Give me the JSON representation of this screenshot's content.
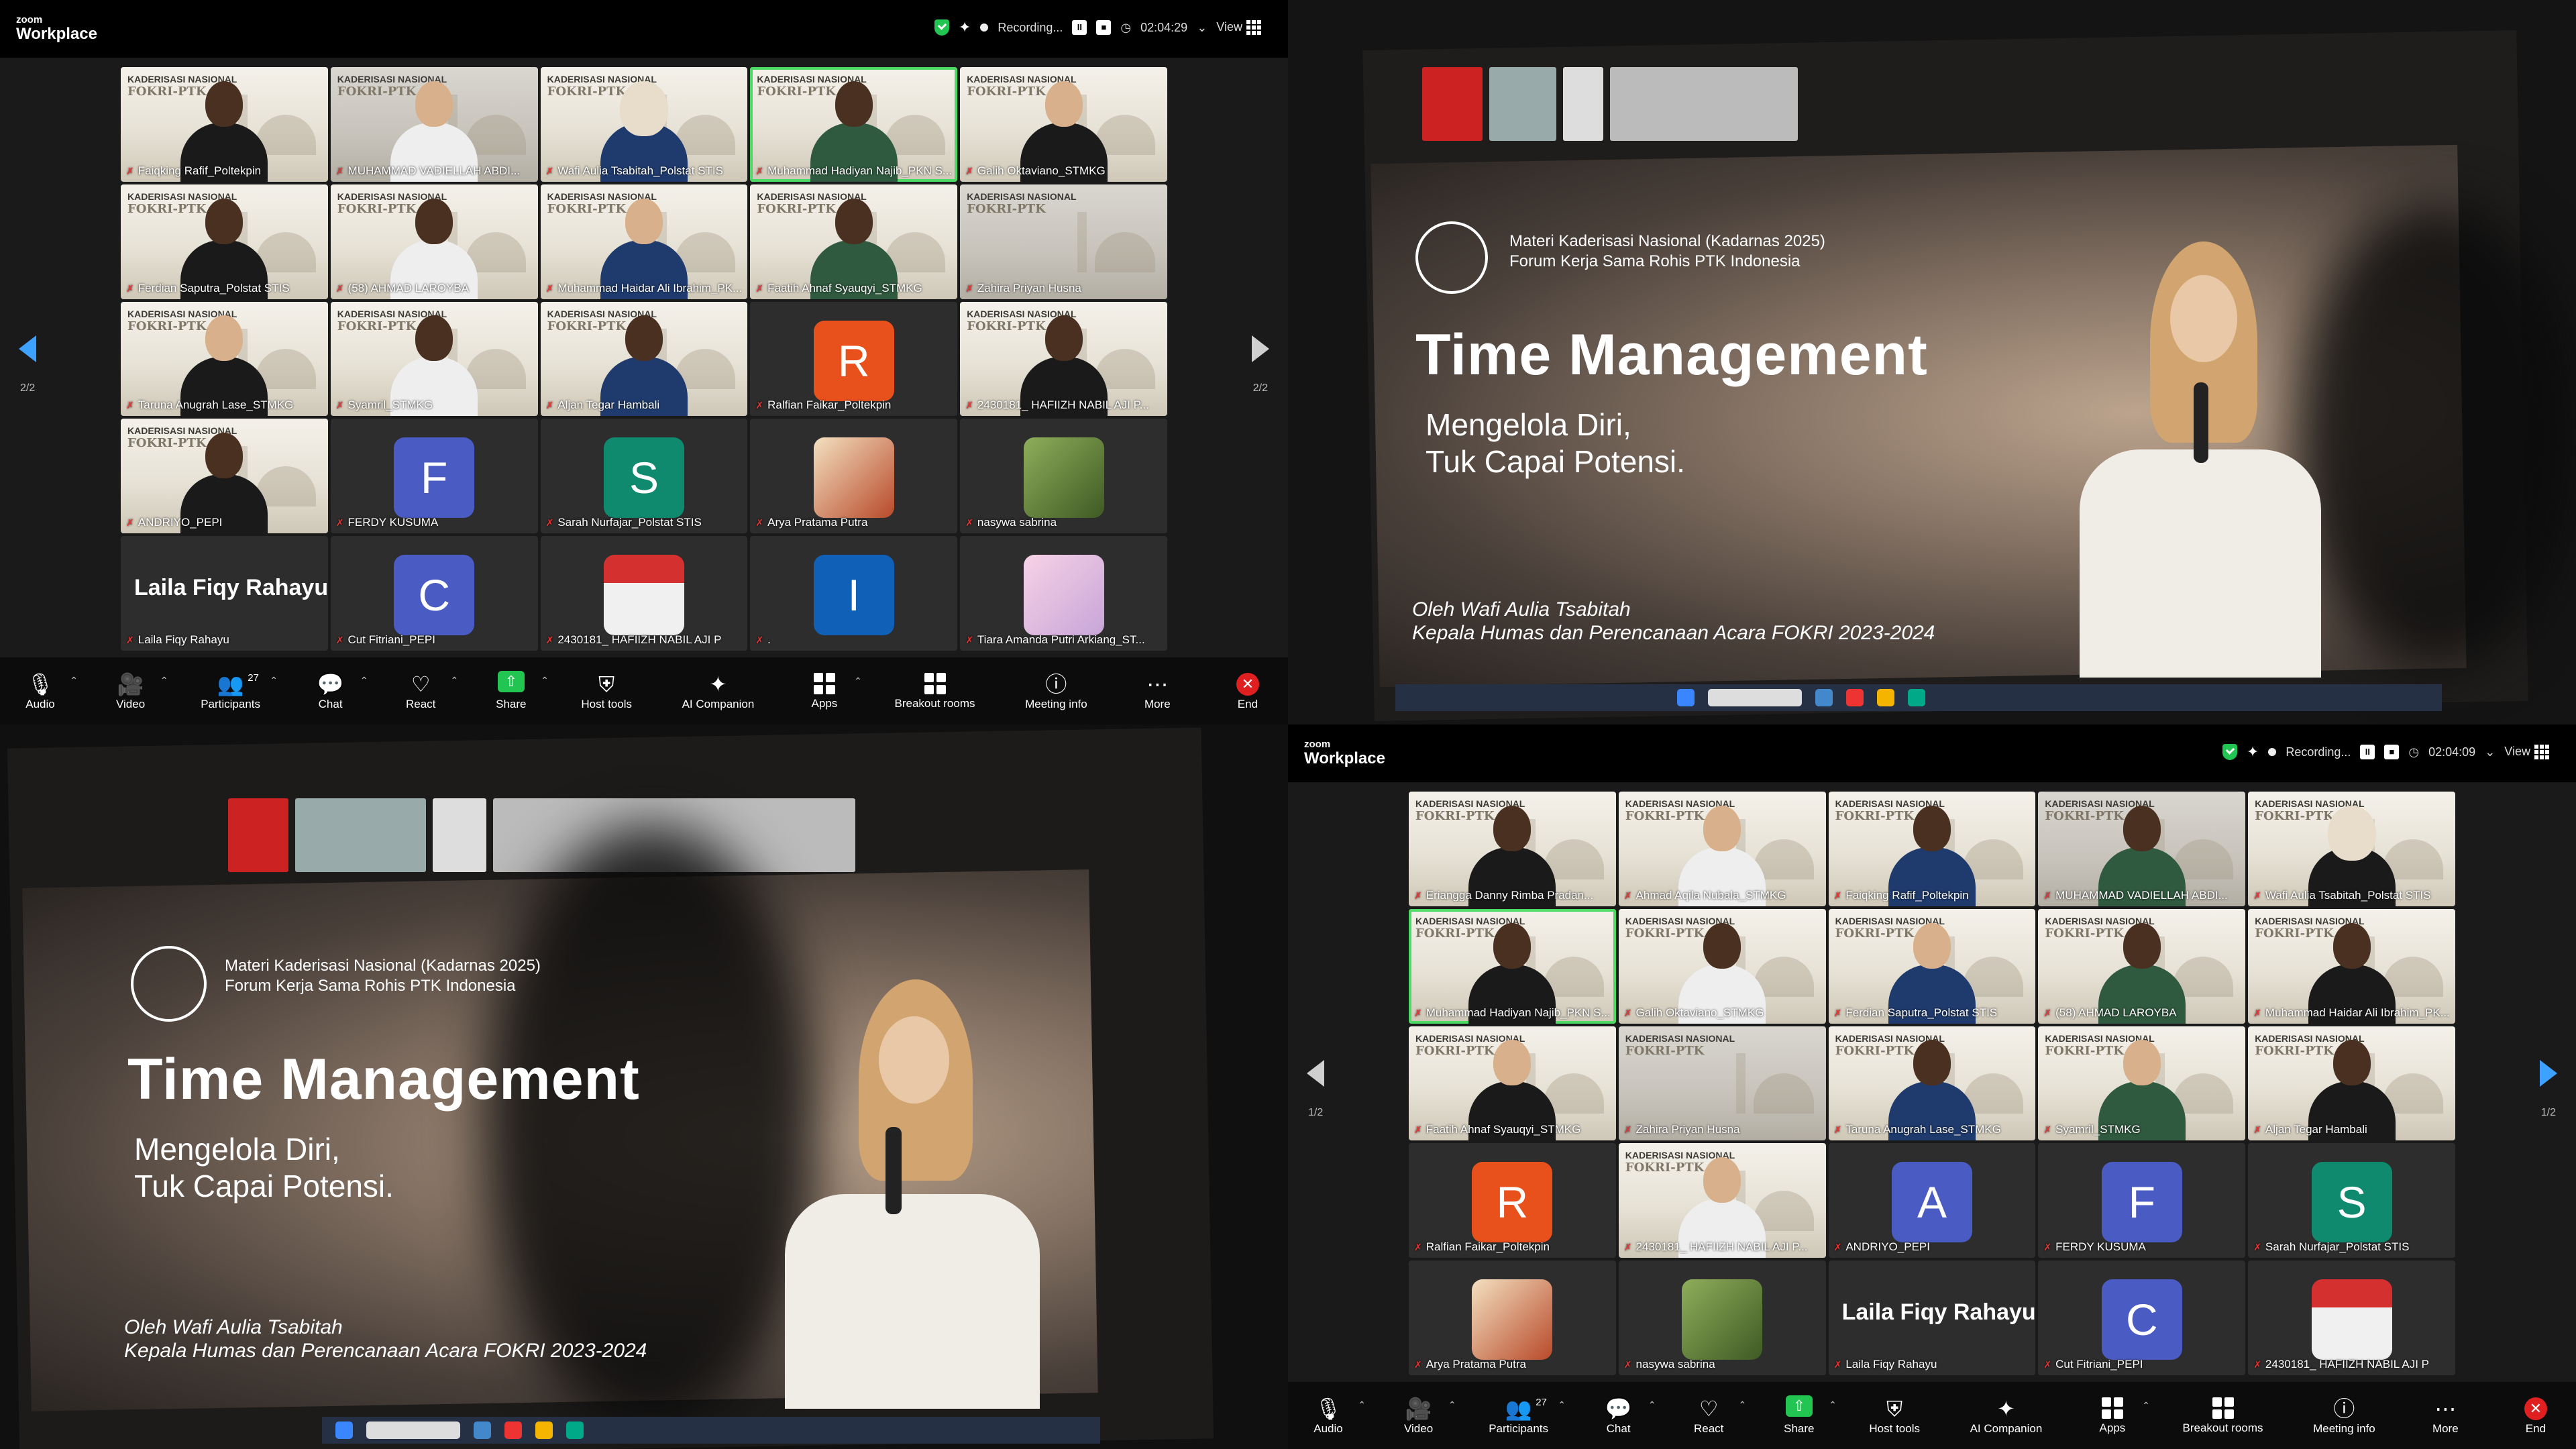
{
  "brand": {
    "small": "zoom",
    "big": "Workplace"
  },
  "recording": {
    "label": "Recording...",
    "pause": "II",
    "stop": "■"
  },
  "timers": {
    "tl": "02:04:29",
    "br": "02:04:09"
  },
  "view_label": "View",
  "page_indicators": {
    "tl": "2/2",
    "br": "1/2"
  },
  "toolbar": {
    "audio": "Audio",
    "video": "Video",
    "participants": "Participants",
    "participants_count": "27",
    "chat": "Chat",
    "react": "React",
    "share": "Share",
    "host_tools": "Host tools",
    "ai_companion": "AI Companion",
    "apps": "Apps",
    "breakout": "Breakout rooms",
    "meeting_info": "Meeting info",
    "more": "More",
    "end": "End"
  },
  "tile_header": {
    "line1": "KADERISASI NASIONAL",
    "line2": "FOKRI-PTK"
  },
  "grid_tl": [
    {
      "name": "Faiqking Rafif_Poltekpin",
      "type": "video"
    },
    {
      "name": "MUHAMMAD VADIELLAH ABDI...",
      "type": "video"
    },
    {
      "name": "Wafi Aulia Tsabitah_Polstat STIS",
      "type": "video"
    },
    {
      "name": "Muhammad Hadiyan Najib_PKN S...",
      "type": "video"
    },
    {
      "name": "Galih Oktaviano_STMKG",
      "type": "video"
    },
    {
      "name": "Ferdian Saputra_Polstat STIS",
      "type": "video"
    },
    {
      "name": "(58) AHMAD LAROYBA",
      "type": "video"
    },
    {
      "name": "Muhammad Haidar Ali Ibrahim_PK...",
      "type": "video"
    },
    {
      "name": "Faatih Ahnaf Syauqyi_STMKG",
      "type": "video"
    },
    {
      "name": "Zahira Priyan Husna",
      "type": "video"
    },
    {
      "name": "Taruna Anugrah Lase_STMKG",
      "type": "video"
    },
    {
      "name": "Syamril_STMKG",
      "type": "video"
    },
    {
      "name": "Aljan Tegar Hambali",
      "type": "video"
    },
    {
      "name": "Ralfian Faikar_Poltekpin",
      "type": "avatar",
      "letter": "R"
    },
    {
      "name": "2430181_ HAFIIZH NABIL AJI P...",
      "type": "video"
    },
    {
      "name": "ANDRIYO_PEPI",
      "type": "video"
    },
    {
      "name": "FERDY KUSUMA",
      "type": "avatar",
      "letter": "F"
    },
    {
      "name": "Sarah Nurfajar_Polstat STIS",
      "type": "avatar",
      "letter": "S"
    },
    {
      "name": "Arya Pratama Putra",
      "type": "photo"
    },
    {
      "name": "nasywa sabrina",
      "type": "photo"
    },
    {
      "name": "Laila Fiqy Rahayu",
      "type": "text",
      "display": "Laila Fiqy Rahayu"
    },
    {
      "name": "Cut Fitriani_PEPI",
      "type": "avatar",
      "letter": "C"
    },
    {
      "name": "2430181_ HAFIIZH NABIL AJI P",
      "type": "photo"
    },
    {
      "name": ".",
      "type": "avatar",
      "letter": "I"
    },
    {
      "name": "Tiara Amanda Putri Arkiang_ST...",
      "type": "photo"
    }
  ],
  "grid_br": [
    {
      "name": "Eriangga Danny Rimba Pradan...",
      "type": "video"
    },
    {
      "name": "Ahmad Aqila Nubala_STMKG",
      "type": "video"
    },
    {
      "name": "Faiqking Rafif_Poltekpin",
      "type": "video"
    },
    {
      "name": "MUHAMMAD VADIELLAH ABDI...",
      "type": "video"
    },
    {
      "name": "Wafi Aulia Tsabitah_Polstat STIS",
      "type": "video"
    },
    {
      "name": "Muhammad Hadiyan Najib_PKN S...",
      "type": "video"
    },
    {
      "name": "Galih Oktaviano_STMKG",
      "type": "video"
    },
    {
      "name": "Ferdian Saputra_Polstat STIS",
      "type": "video"
    },
    {
      "name": "(58) AHMAD LAROYBA",
      "type": "video"
    },
    {
      "name": "Muhammad Haidar Ali Ibrahim_PK...",
      "type": "video"
    },
    {
      "name": "Faatih Ahnaf Syauqyi_STMKG",
      "type": "video"
    },
    {
      "name": "Zahira Priyan Husna",
      "type": "video"
    },
    {
      "name": "Taruna Anugrah Lase_STMKG",
      "type": "video"
    },
    {
      "name": "Syamril_STMKG",
      "type": "video"
    },
    {
      "name": "Aljan Tegar Hambali",
      "type": "video"
    },
    {
      "name": "Ralfian Faikar_Poltekpin",
      "type": "avatar",
      "letter": "R"
    },
    {
      "name": "2430181_ HAFIIZH NABIL AJI P...",
      "type": "video"
    },
    {
      "name": "ANDRIYO_PEPI",
      "type": "avatar",
      "letter": "A"
    },
    {
      "name": "FERDY KUSUMA",
      "type": "avatar",
      "letter": "F"
    },
    {
      "name": "Sarah Nurfajar_Polstat STIS",
      "type": "avatar",
      "letter": "S"
    },
    {
      "name": "Arya Pratama Putra",
      "type": "photo"
    },
    {
      "name": "nasywa sabrina",
      "type": "photo"
    },
    {
      "name": "Laila Fiqy Rahayu",
      "type": "text",
      "display": "Laila Fiqy Rahayu"
    },
    {
      "name": "Cut Fitriani_PEPI",
      "type": "avatar",
      "letter": "C"
    },
    {
      "name": "2430181_ HAFIIZH NABIL AJI P",
      "type": "photo"
    }
  ],
  "avatar_colors": {
    "R": "#e8501c",
    "F": "#4a5bc4",
    "S": "#0f8a6e",
    "C": "#4a5bc4",
    "I": "#1060b8",
    "A": "#4a5bc4"
  },
  "slide": {
    "org_line1": "Materi Kaderisasi Nasional (Kadarnas 2025)",
    "org_line2": "Forum Kerja Sama Rohis PTK Indonesia",
    "title": "Time Management",
    "sub1": "Mengelola Diri,",
    "sub2": "Tuk Capai Potensi.",
    "by1": "Oleh Wafi Aulia Tsabitah",
    "by2": "Kepala Humas dan Perencanaan Acara FOKRI 2023-2024"
  }
}
